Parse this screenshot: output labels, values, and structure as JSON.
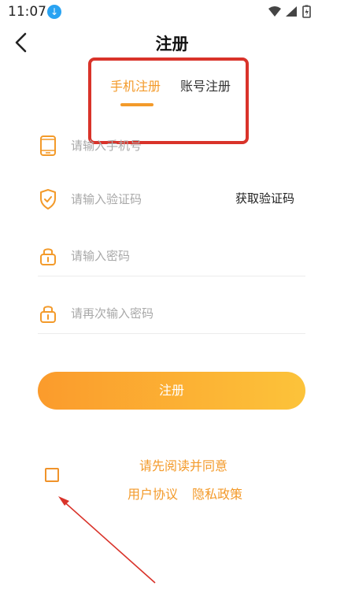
{
  "status_bar": {
    "time": "11:07"
  },
  "header": {
    "title": "注册"
  },
  "tabs": [
    {
      "label": "手机注册",
      "active": true
    },
    {
      "label": "账号注册",
      "active": false
    }
  ],
  "form": {
    "phone_placeholder": "请输入手机号",
    "code_placeholder": "请输入验证码",
    "get_code_label": "获取验证码",
    "password_placeholder": "请输入密码",
    "confirm_password_placeholder": "请再次输入密码",
    "submit_label": "注册"
  },
  "agreement": {
    "prompt": "请先阅读并同意",
    "user_agreement": "用户协议",
    "privacy_policy": "隐私政策",
    "checked": false
  },
  "colors": {
    "accent": "#f39a2a",
    "button_start": "#fb9b2c",
    "button_end": "#fcc33a",
    "annotation": "#d9332a"
  }
}
